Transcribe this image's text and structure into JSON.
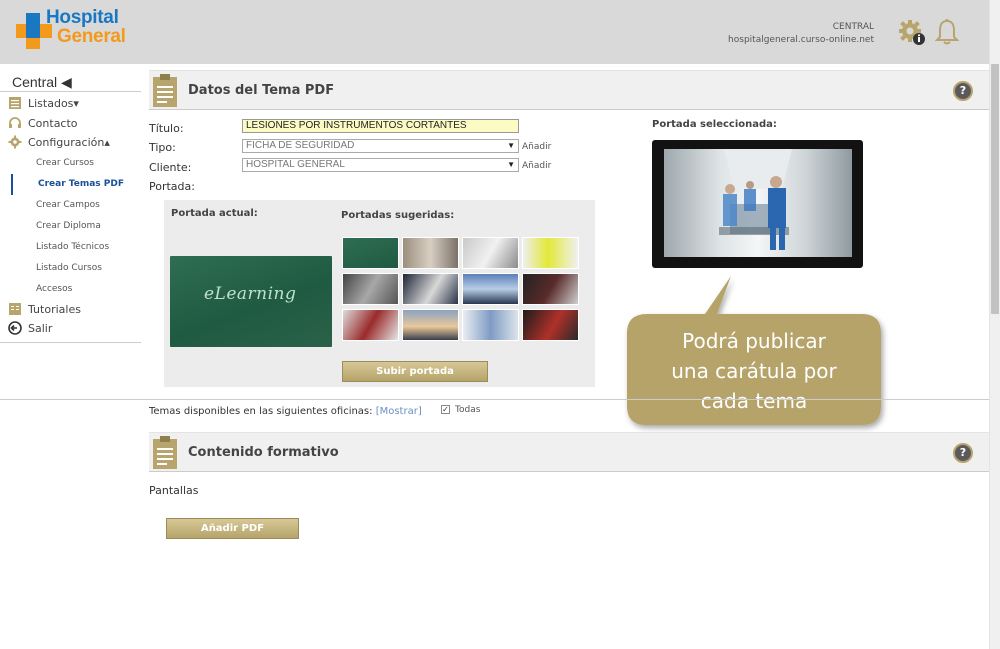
{
  "header": {
    "logo_line1": "Hospital",
    "logo_line2": "General",
    "account_name": "CENTRAL",
    "account_domain": "hospitalgeneral.curso-online.net"
  },
  "sidebar": {
    "title": "Central ◀",
    "items": [
      {
        "label": "Listados▾"
      },
      {
        "label": "Contacto"
      },
      {
        "label": "Configuración▴"
      }
    ],
    "sub_items": [
      {
        "label": "Crear Cursos"
      },
      {
        "label": "Crear Temas PDF"
      },
      {
        "label": "Crear Campos"
      },
      {
        "label": "Crear Diploma"
      },
      {
        "label": "Listado Técnicos"
      },
      {
        "label": "Listado Cursos"
      },
      {
        "label": "Accesos"
      }
    ],
    "bottom_items": [
      {
        "label": "Tutoriales"
      },
      {
        "label": "Salir"
      }
    ]
  },
  "section1": {
    "title": "Datos del Tema PDF",
    "help": "?",
    "titulo_label": "Título:",
    "titulo_value": "LESIONES POR INSTRUMENTOS CORTANTES",
    "tipo_label": "Tipo:",
    "tipo_value": "FICHA DE SEGURIDAD",
    "cliente_label": "Cliente:",
    "cliente_value": "HOSPITAL GENERAL",
    "add_label": "Añadir",
    "portada_label": "Portada:",
    "portada_actual": "Portada actual:",
    "chalk_text": "eLearning",
    "portadas_sugeridas": "Portadas sugeridas:",
    "subir_portada": "Subir portada",
    "portada_seleccionada": "Portada seleccionada:",
    "oficinas_text": "Temas disponibles en las siguientes oficinas:",
    "mostrar": "[Mostrar]",
    "todas": "Todas"
  },
  "callout": {
    "line1": "Podrá publicar",
    "line2": "una carátula por",
    "line3": "cada tema"
  },
  "section2": {
    "title": "Contenido formativo",
    "help": "?",
    "pantallas": "Pantallas",
    "add_pdf": "Añadir PDF"
  },
  "colors": {
    "brand_blue": "#1a78c2",
    "brand_orange": "#f39a1c",
    "gold_button": "#c4b27c",
    "callout": "#b5a36b",
    "active_link": "#1a4f9a"
  }
}
